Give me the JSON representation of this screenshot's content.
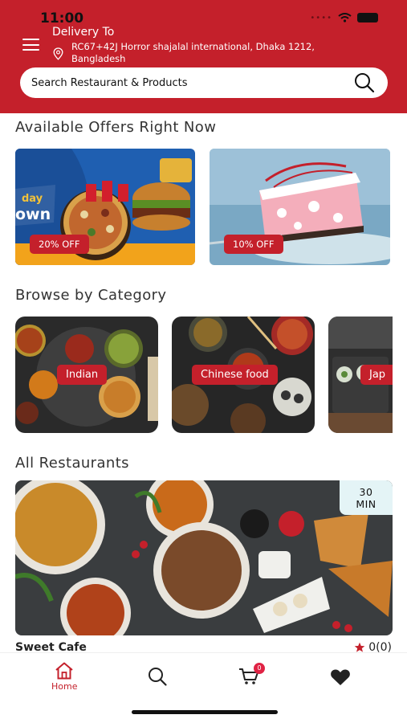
{
  "status_bar": {
    "time": "11:00"
  },
  "header": {
    "delivery_title": "Delivery To",
    "address": "RC67+42J Horror shajalal international, Dhaka 1212, Bangladesh",
    "search_placeholder": "Search Restaurant & Products"
  },
  "offers": {
    "title": "Available Offers Right Now",
    "items": [
      {
        "badge": "20% OFF",
        "image": "pizza-burger-promo"
      },
      {
        "badge": "10% OFF",
        "image": "cheesecake-slice"
      }
    ]
  },
  "categories": {
    "title": "Browse by Category",
    "items": [
      {
        "label": "Indian"
      },
      {
        "label": "Chinese food"
      },
      {
        "label": "Jap"
      }
    ]
  },
  "restaurants": {
    "title": "All Restaurants",
    "items": [
      {
        "name": "Sweet Cafe",
        "time_value": "30",
        "time_unit": "MIN",
        "rating": "0(0)"
      }
    ]
  },
  "bottom_nav": {
    "items": [
      {
        "label": "Home",
        "icon": "home-icon",
        "active": true
      },
      {
        "label": "",
        "icon": "search-icon"
      },
      {
        "label": "",
        "icon": "cart-icon",
        "badge": "0"
      },
      {
        "label": "",
        "icon": "heart-icon"
      }
    ]
  },
  "colors": {
    "brand": "#c4202b",
    "badge": "#e02344",
    "time_badge_bg": "#e4f4f6"
  }
}
